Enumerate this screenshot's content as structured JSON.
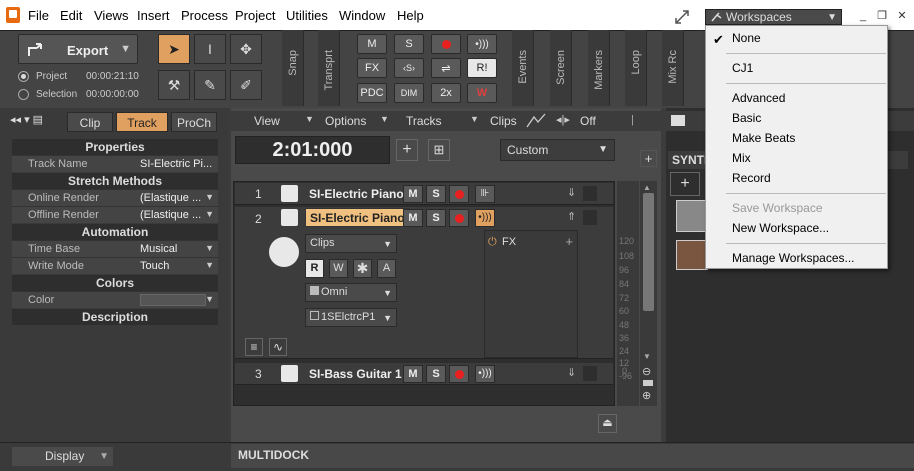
{
  "menubar": {
    "items": [
      "File",
      "Edit",
      "Views",
      "Insert",
      "Process",
      "Project",
      "Utilities",
      "Window",
      "Help"
    ],
    "workspaces_label": "Workspaces"
  },
  "toolbar": {
    "export_label": "Export",
    "project_label": "Project",
    "project_time": "00:00:21:10",
    "selection_label": "Selection",
    "selection_time": "00:00:00:00",
    "snap_label": "Snap",
    "transport_label": "Transprt",
    "transport_buttons": [
      "M",
      "S",
      "PDC",
      "DIM",
      "2x",
      "FX",
      "R!"
    ],
    "events_label": "Events",
    "screen_label": "Screen",
    "markers_label": "Markers",
    "loop_label": "Loop",
    "mix_label": "Mix Rc"
  },
  "inspector": {
    "tabs": [
      "Clip",
      "Track",
      "ProCh"
    ],
    "active_tab": "Track",
    "sections": {
      "properties": "Properties",
      "stretch": "Stretch Methods",
      "automation": "Automation",
      "colors": "Colors",
      "description": "Description"
    },
    "rows": {
      "track_name": {
        "key": "Track Name",
        "value": "SI-Electric Pi..."
      },
      "online_render": {
        "key": "Online Render",
        "value": "(Elastique ..."
      },
      "offline_render": {
        "key": "Offline Render",
        "value": "(Elastique ..."
      },
      "time_base": {
        "key": "Time Base",
        "value": "Musical"
      },
      "write_mode": {
        "key": "Write Mode",
        "value": "Touch"
      },
      "color": {
        "key": "Color",
        "value": ""
      }
    }
  },
  "arrange": {
    "menu": [
      "View",
      "Options",
      "Tracks",
      "Clips"
    ],
    "edit_filter": "Off",
    "time_display": "2:01:000",
    "custom_label": "Custom",
    "tracks": [
      {
        "num": "1",
        "name": "SI-Electric Piano"
      },
      {
        "num": "2",
        "name": "SI-Electric Piano"
      },
      {
        "num": "3",
        "name": "SI-Bass Guitar 1"
      }
    ],
    "track2": {
      "clips_label": "Clips",
      "rw_buttons": [
        "R",
        "W",
        "✱",
        "A"
      ],
      "input": "Omni",
      "output": "1SElctrcP1",
      "fx_label": "FX"
    },
    "ruler_values": [
      "120",
      "108",
      "96",
      "84",
      "72",
      "60",
      "48",
      "36",
      "24",
      "12",
      "0",
      "-96"
    ]
  },
  "rightpanel": {
    "synth_label": "SYNTH"
  },
  "bottom": {
    "display_label": "Display",
    "multidock_label": "MULTIDOCK"
  },
  "workspaces_menu": {
    "checked_item": "None",
    "items": [
      "None",
      "CJ1",
      "Advanced",
      "Basic",
      "Make Beats",
      "Mix",
      "Record",
      "Save Workspace",
      "New Workspace...",
      "Manage Workspaces..."
    ]
  },
  "colors": {
    "accent_orange": "#e0a060",
    "record_red": "#e82020",
    "selected_track_name": "#f0c080"
  }
}
